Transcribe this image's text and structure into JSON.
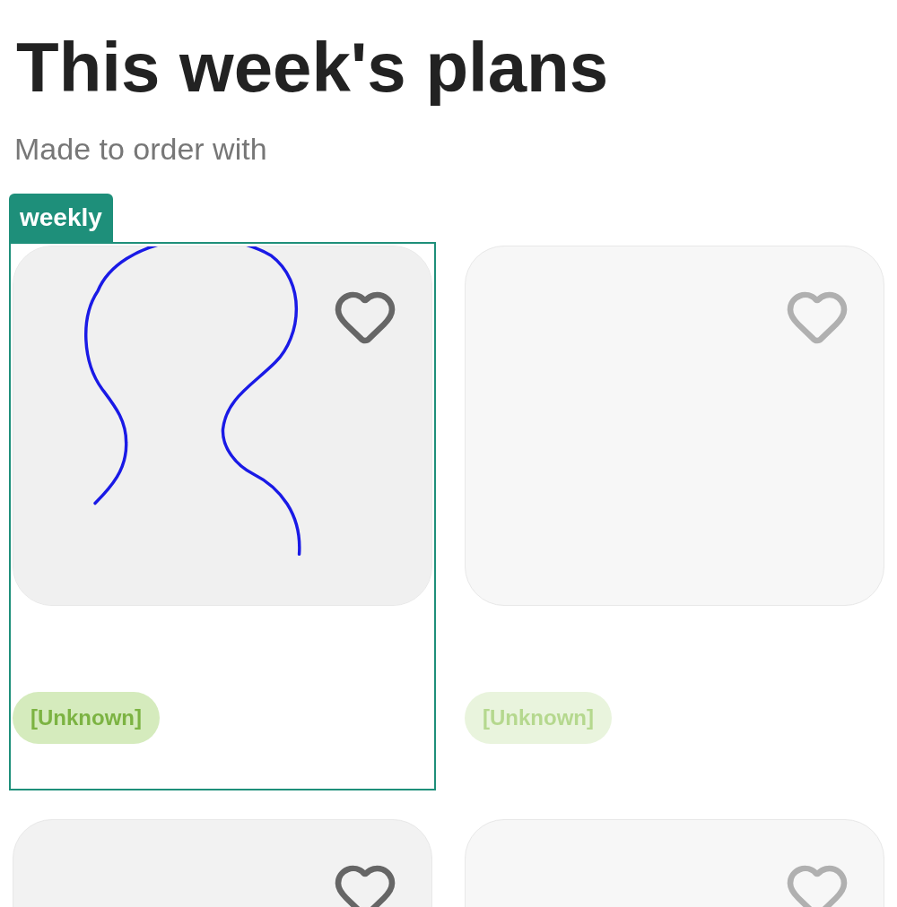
{
  "title": "This week's plans",
  "subtitle": "Made to order with",
  "plans": [
    {
      "badge": "weekly",
      "selected": true,
      "disabled": false,
      "tag": "[Unknown]"
    },
    {
      "selected": false,
      "disabled": true,
      "tag": "[Unknown]"
    },
    {
      "selected": false,
      "disabled": false
    },
    {
      "selected": false,
      "disabled": true
    }
  ]
}
